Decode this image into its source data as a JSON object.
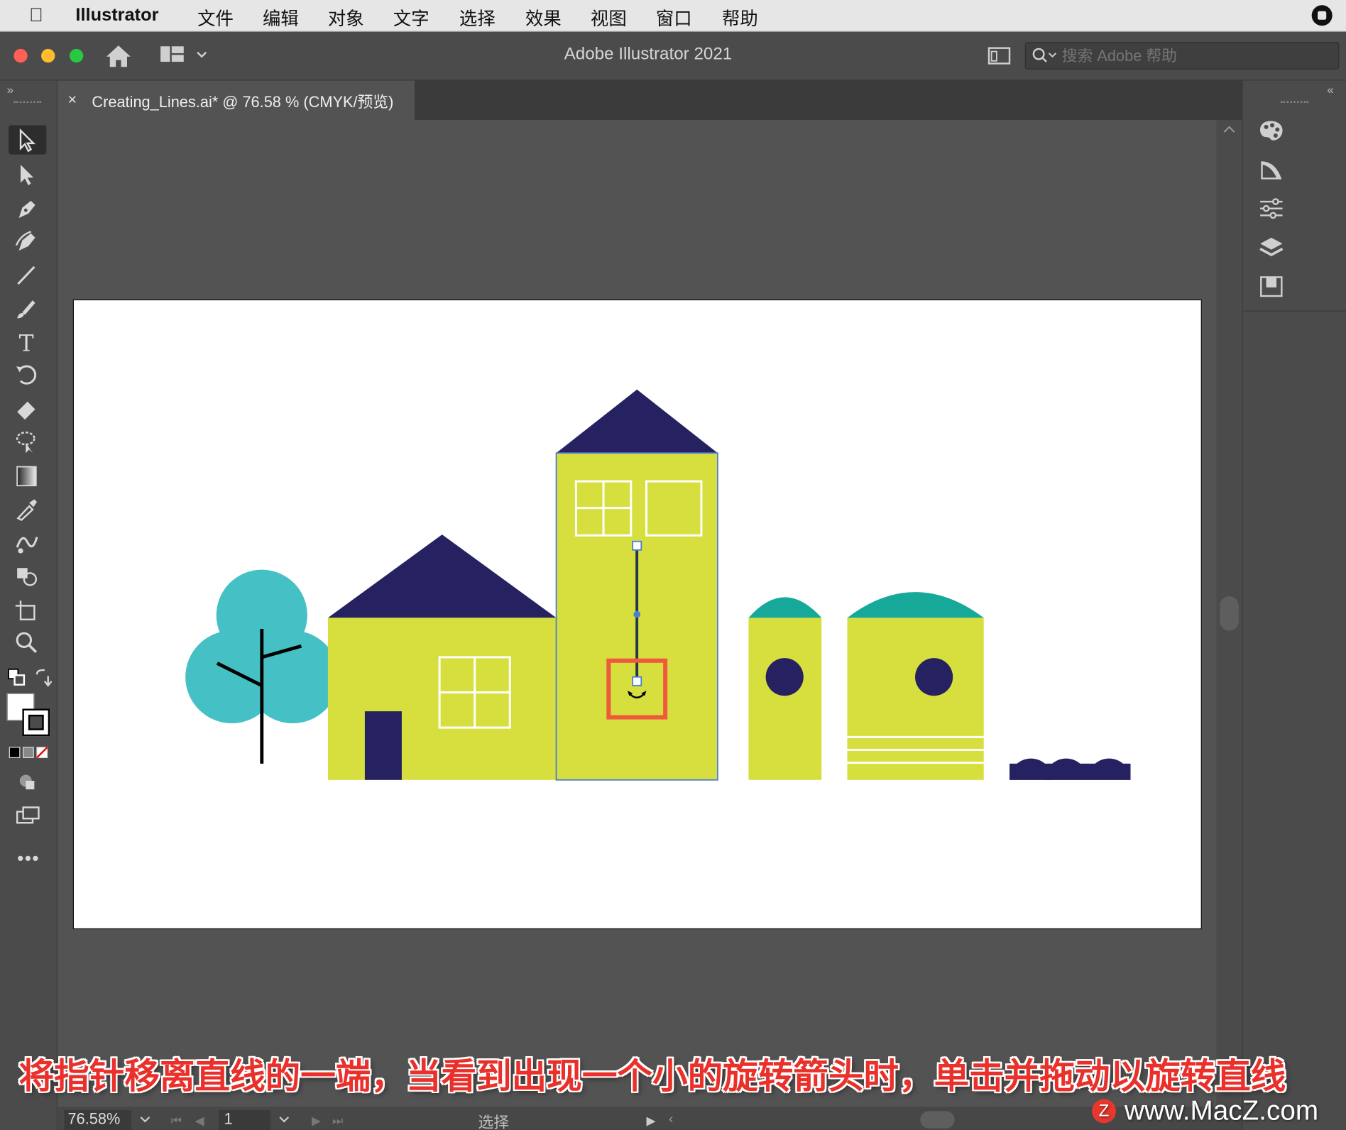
{
  "menubar": {
    "app_name": "Illustrator",
    "items": [
      "文件",
      "编辑",
      "对象",
      "文字",
      "选择",
      "效果",
      "视图",
      "窗口",
      "帮助"
    ]
  },
  "titlebar": {
    "window_title": "Adobe Illustrator 2021",
    "search_placeholder": "搜索 Adobe 帮助"
  },
  "document": {
    "tab_label": "Creating_Lines.ai* @ 76.58 % (CMYK/预览)",
    "close_glyph": "×"
  },
  "statusbar": {
    "zoom": "76.58%",
    "artboard_number": "1",
    "tool_mode": "选择"
  },
  "caption": "将指针移离直线的一端，当看到出现一个小的旋转箭头时，单击并拖动以旋转直线",
  "watermark": "www.MacZ.com",
  "colors": {
    "navy": "#262262",
    "lime": "#d7df3f",
    "teal_light": "#45c0c4",
    "teal_dark": "#16a99a",
    "highlight_red": "#ee5a3e",
    "selection_blue": "#4a7fd6"
  },
  "toolbar_tools": [
    "selection-tool",
    "direct-selection-tool",
    "pen-tool",
    "curvature-tool",
    "line-segment-tool",
    "paintbrush-tool",
    "type-tool",
    "rotate-tool",
    "eraser-tool",
    "lasso-tool",
    "gradient-tool",
    "eyedropper-tool",
    "blend-tool",
    "shape-builder-tool",
    "artboard-tool",
    "zoom-tool"
  ]
}
